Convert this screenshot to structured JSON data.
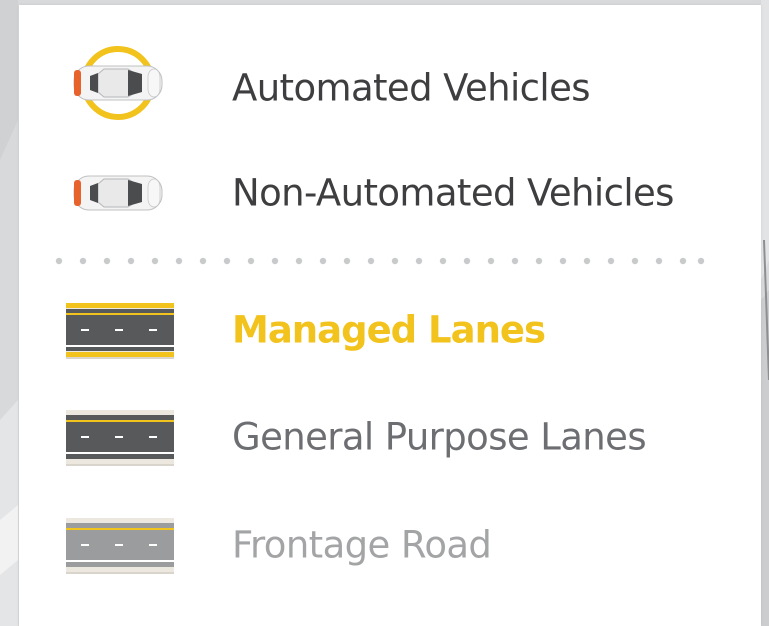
{
  "legend": {
    "items": [
      {
        "label": "Automated Vehicles",
        "icon": "automated-vehicle-icon",
        "color": "#3e3e40",
        "bold": false
      },
      {
        "label": "Non-Automated Vehicles",
        "icon": "non-automated-vehicle-icon",
        "color": "#3e3e40",
        "bold": false
      },
      {
        "label": "Managed Lanes",
        "icon": "managed-lanes-icon",
        "color": "#f2c21d",
        "bold": true
      },
      {
        "label": "General Purpose Lanes",
        "icon": "general-purpose-lanes-icon",
        "color": "#6d6e71",
        "bold": false
      },
      {
        "label": "Frontage Road",
        "icon": "frontage-road-icon",
        "color": "#a3a4a6",
        "bold": false
      }
    ]
  },
  "colors": {
    "accent_yellow": "#f2c21d",
    "road_dark": "#58595b",
    "road_light": "#9b9c9e",
    "divider_dot": "#c9cacc",
    "car_orange": "#e8622c"
  }
}
